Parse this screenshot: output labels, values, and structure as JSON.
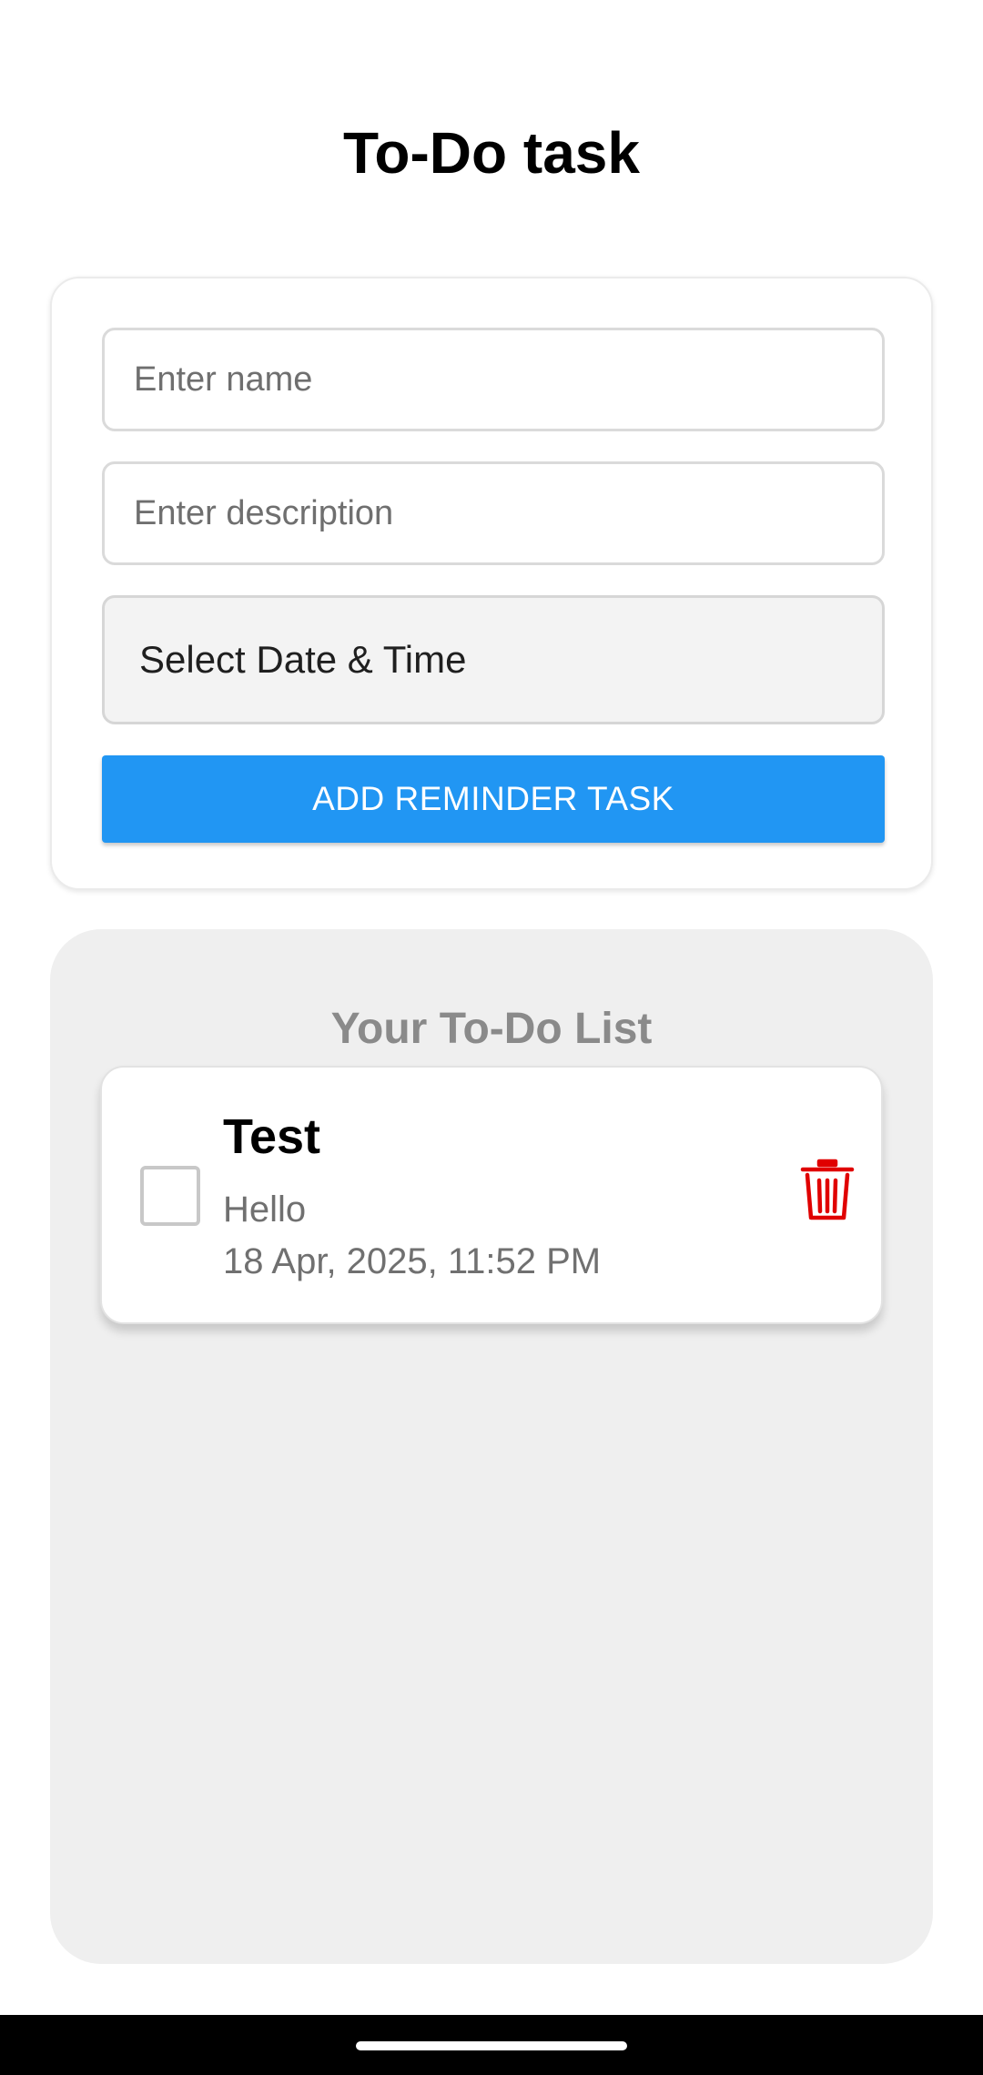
{
  "header": {
    "title": "To-Do task"
  },
  "form": {
    "name_placeholder": "Enter name",
    "name_value": "",
    "description_placeholder": "Enter description",
    "description_value": "",
    "date_time_label": "Select Date & Time",
    "add_button_label": "ADD REMINDER TASK"
  },
  "list": {
    "title": "Your To-Do List",
    "tasks": [
      {
        "name": "Test",
        "description": "Hello",
        "datetime": "18 Apr, 2025, 11:52 PM",
        "completed": false,
        "delete_icon": "trash-icon"
      }
    ]
  },
  "colors": {
    "accent": "#2196f3",
    "delete": "#e00000",
    "panel_background": "#efefef"
  }
}
